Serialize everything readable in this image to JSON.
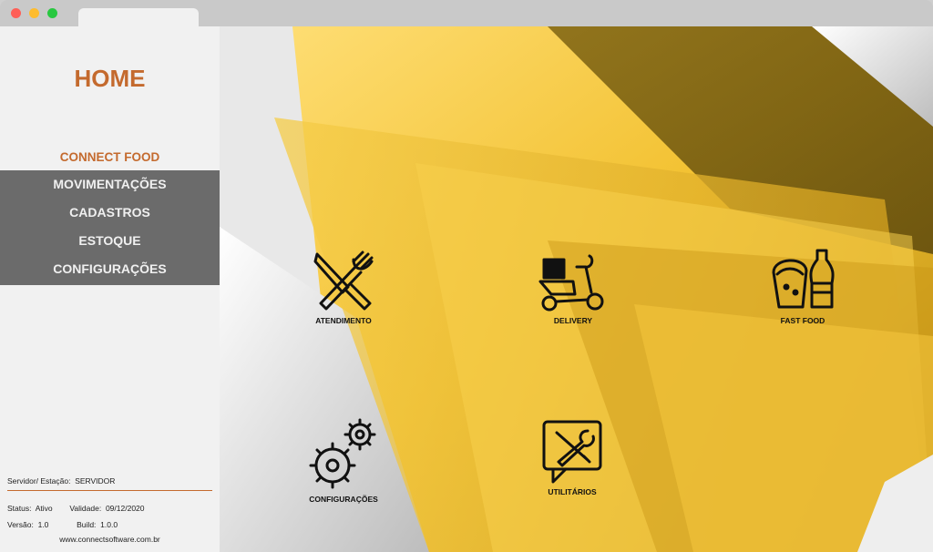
{
  "window": {
    "tab_label": ""
  },
  "sidebar": {
    "home_title": "HOME",
    "section_title": "CONNECT FOOD",
    "menu": [
      {
        "label": "MOVIMENTAÇÕES"
      },
      {
        "label": "CADASTROS"
      },
      {
        "label": "ESTOQUE"
      },
      {
        "label": "CONFIGURAÇÕES"
      }
    ],
    "footer": {
      "server_label": "Servidor/ Estação:",
      "server_value": "SERVIDOR",
      "status_label": "Status:",
      "status_value": "Ativo",
      "validity_label": "Validade:",
      "validity_value": "09/12/2020",
      "version_label": "Versão:",
      "version_value": "1.0",
      "build_label": "Build:",
      "build_value": "1.0.0",
      "website": "www.connectsoftware.com.br"
    }
  },
  "tiles": [
    {
      "label": "ATENDIMENTO",
      "icon": "knife-fork-icon"
    },
    {
      "label": "DELIVERY",
      "icon": "delivery-scooter-icon"
    },
    {
      "label": "FAST FOOD",
      "icon": "burrito-soda-icon"
    },
    {
      "label": "CONFIGURAÇÕES",
      "icon": "gears-icon"
    },
    {
      "label": "UTILITÁRIOS",
      "icon": "tools-chat-icon"
    }
  ],
  "colors": {
    "accent": "#c46a2e",
    "menu_bg": "#6b6b6b",
    "sidebar_bg": "#f1f1f1",
    "background_gold": "#f3c33a"
  }
}
